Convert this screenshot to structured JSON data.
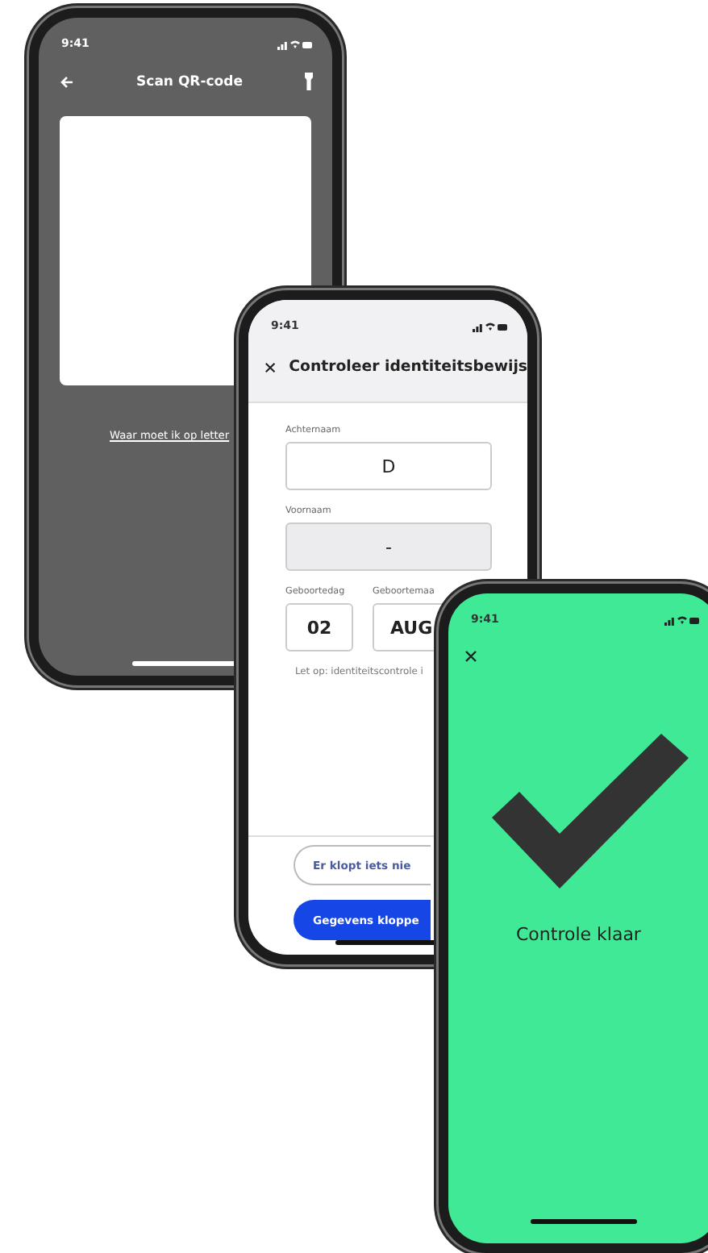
{
  "phones": [
    {
      "kind": "scanner",
      "status_time": "9:41",
      "title": "Scan QR-code",
      "link": "Waar moet ik op letter"
    },
    {
      "kind": "form",
      "status_time": "9:41",
      "title": "Controleer identiteitsbewijs",
      "fields": [
        {
          "label": "Achternaam",
          "value": "D",
          "disabled": false
        },
        {
          "label": "Voornaam",
          "value": "-",
          "disabled": true
        }
      ],
      "date_fields": [
        {
          "label": "Geboortedag",
          "value": "02"
        },
        {
          "label": "Geboortemaa",
          "value": "AUG"
        }
      ],
      "note": "Let op: identiteitscontrole i",
      "buttons": [
        {
          "label": "Er klopt iets nie",
          "kind": "secondary"
        },
        {
          "label": "Gegevens kloppe",
          "kind": "primary"
        }
      ]
    },
    {
      "kind": "success",
      "status_time": "9:41",
      "message": "Controle klaar"
    }
  ]
}
